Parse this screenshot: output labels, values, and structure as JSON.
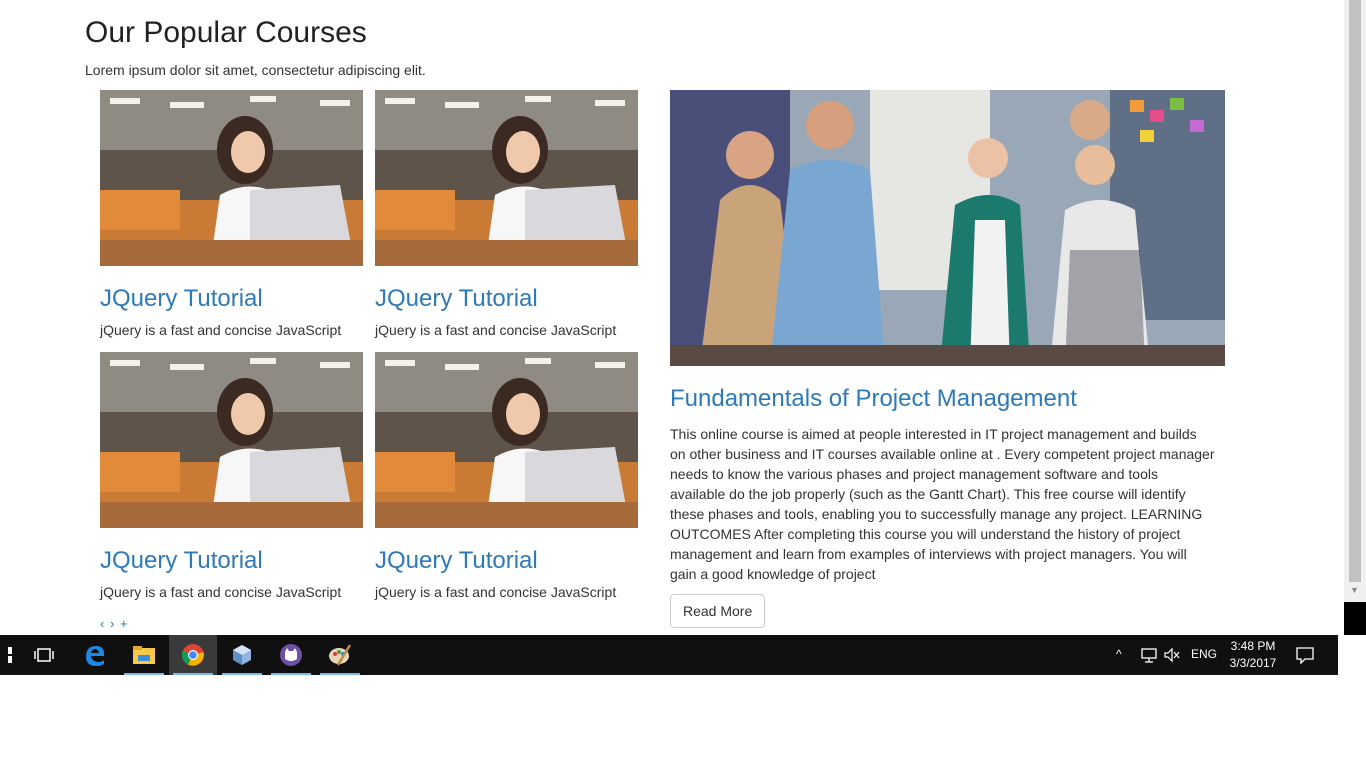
{
  "section": {
    "title": "Our Popular Courses",
    "subtitle": "Lorem ipsum dolor sit amet, consectetur adipiscing elit."
  },
  "courses": [
    {
      "title": "JQuery Tutorial",
      "desc": "jQuery is a fast and concise JavaScript"
    },
    {
      "title": "JQuery Tutorial",
      "desc": "jQuery is a fast and concise JavaScript"
    },
    {
      "title": "JQuery Tutorial",
      "desc": "jQuery is a fast and concise JavaScript"
    },
    {
      "title": "JQuery Tutorial",
      "desc": "jQuery is a fast and concise JavaScript"
    }
  ],
  "pager": {
    "prev": "‹",
    "next": "›",
    "add": "+"
  },
  "feature": {
    "title": "Fundamentals of Project Management",
    "body": "This online course is aimed at people interested in IT project management and builds on other business and IT courses available online at . Every competent project manager needs to know the various phases and project management software and tools available do the job properly (such as the Gantt Chart). This free course will identify these phases and tools, enabling you to successfully manage any project. LEARNING OUTCOMES After completing this course you will understand the history of project management and learn from examples of interviews with project managers. You will gain a good knowledge of project",
    "button": "Read More"
  },
  "taskbar": {
    "language": "ENG",
    "time": "3:48 PM",
    "date": "3/3/2017",
    "apps": [
      "start-icon",
      "task-view-icon",
      "edge-icon",
      "file-explorer-icon",
      "chrome-icon",
      "virtualbox-icon",
      "app-cat-icon",
      "paint-icon"
    ]
  },
  "colors": {
    "link": "#2d7ab8",
    "taskbar": "#101010",
    "accent": "#76b9ed"
  }
}
